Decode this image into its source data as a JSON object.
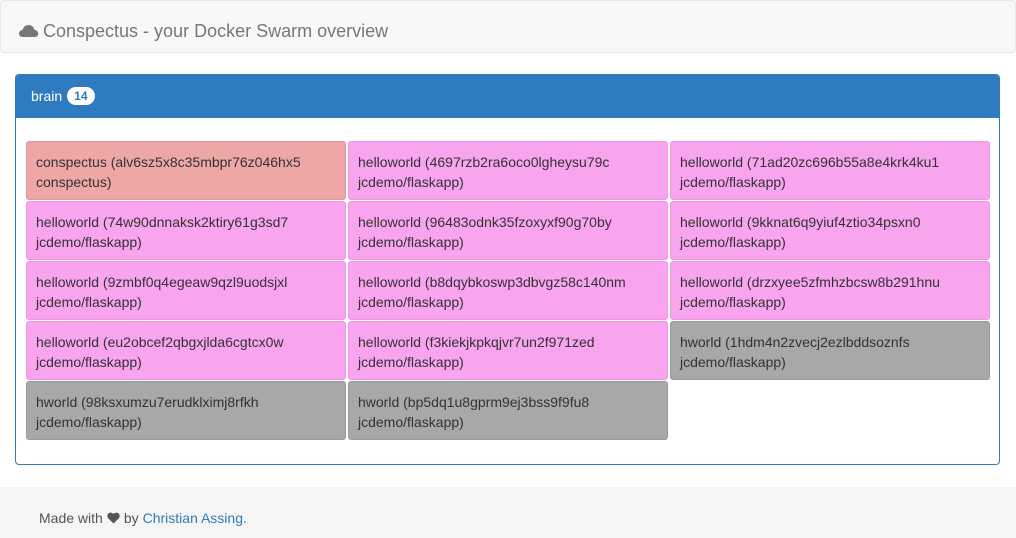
{
  "header": {
    "title": "Conspectus - your Docker Swarm overview",
    "icon": "cloud-icon"
  },
  "node": {
    "name": "brain",
    "count": "14",
    "tasks": [
      {
        "type": "conspectus",
        "line1": "conspectus (alv6sz5x8c35mbpr76z046hx5",
        "line2": "conspectus)",
        "color": "#eea6a6"
      },
      {
        "type": "helloworld",
        "line1": "helloworld (4697rzb2ra6oco0lgheysu79c",
        "line2": "jcdemo/flaskapp)",
        "color": "#f8a4ee"
      },
      {
        "type": "helloworld",
        "line1": "helloworld (71ad20zc696b55a8e4krk4ku1",
        "line2": "jcdemo/flaskapp)",
        "color": "#f8a4ee"
      },
      {
        "type": "helloworld",
        "line1": "helloworld (74w90dnnaksk2ktiry61g3sd7",
        "line2": "jcdemo/flaskapp)",
        "color": "#f8a4ee"
      },
      {
        "type": "helloworld",
        "line1": "helloworld (96483odnk35fzoxyxf90g70by",
        "line2": "jcdemo/flaskapp)",
        "color": "#f8a4ee"
      },
      {
        "type": "helloworld",
        "line1": "helloworld (9kknat6q9yiuf4ztio34psxn0",
        "line2": "jcdemo/flaskapp)",
        "color": "#f8a4ee"
      },
      {
        "type": "helloworld",
        "line1": "helloworld (9zmbf0q4egeaw9qzl9uodsjxl",
        "line2": "jcdemo/flaskapp)",
        "color": "#f8a4ee"
      },
      {
        "type": "helloworld",
        "line1": "helloworld (b8dqybkoswp3dbvgz58c140nm",
        "line2": "jcdemo/flaskapp)",
        "color": "#f8a4ee"
      },
      {
        "type": "helloworld",
        "line1": "helloworld (drzxyee5zfmhzbcsw8b291hnu",
        "line2": "jcdemo/flaskapp)",
        "color": "#f8a4ee"
      },
      {
        "type": "helloworld",
        "line1": "helloworld (eu2obcef2qbgxjlda6cgtcx0w",
        "line2": "jcdemo/flaskapp)",
        "color": "#f8a4ee"
      },
      {
        "type": "helloworld",
        "line1": "helloworld (f3kiekjkpkqjvr7un2f971zed",
        "line2": "jcdemo/flaskapp)",
        "color": "#f8a4ee"
      },
      {
        "type": "hworld",
        "line1": "hworld (1hdm4n2zvecj2ezlbddsoznfs",
        "line2": "jcdemo/flaskapp)",
        "color": "#a8a8ab"
      },
      {
        "type": "hworld",
        "line1": "hworld (98ksxumzu7erudklximj8rfkh",
        "line2": "jcdemo/flaskapp)",
        "color": "#a8a8ab"
      },
      {
        "type": "hworld",
        "line1": "hworld (bp5dq1u8gprm9ej3bss9f9fu8",
        "line2": "jcdemo/flaskapp)",
        "color": "#a8a8ab"
      }
    ]
  },
  "footer": {
    "made_with": "Made with",
    "heart_icon": "heart-icon",
    "by": "by",
    "author": "Christian Assing."
  },
  "colors": {
    "panel_primary": "#2f7bbf",
    "conspectus": "#eea6a6",
    "helloworld": "#f8a4ee",
    "hworld": "#a8a8ab"
  }
}
